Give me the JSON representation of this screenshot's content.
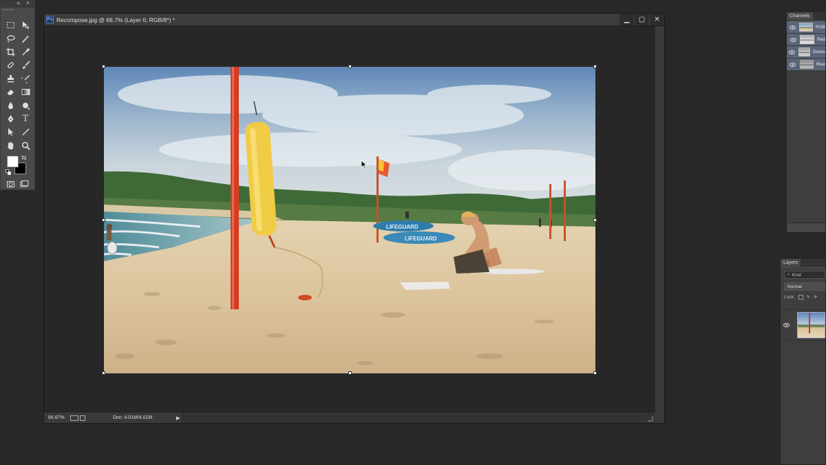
{
  "tools_panel": {
    "collapse_glyph": "«",
    "close_glyph": "×",
    "tools": [
      {
        "name": "rect-marquee-icon"
      },
      {
        "name": "move-icon"
      },
      {
        "name": "lasso-icon"
      },
      {
        "name": "magic-wand-icon"
      },
      {
        "name": "crop-icon"
      },
      {
        "name": "eyedropper-icon"
      },
      {
        "name": "healing-brush-icon"
      },
      {
        "name": "brush-icon"
      },
      {
        "name": "clone-stamp-icon"
      },
      {
        "name": "history-brush-icon"
      },
      {
        "name": "eraser-icon"
      },
      {
        "name": "gradient-icon"
      },
      {
        "name": "blur-icon"
      },
      {
        "name": "dodge-icon"
      },
      {
        "name": "pen-icon"
      },
      {
        "name": "type-icon"
      },
      {
        "name": "path-select-icon"
      },
      {
        "name": "line-icon"
      },
      {
        "name": "hand-icon"
      },
      {
        "name": "zoom-icon"
      }
    ],
    "type_glyph": "T",
    "foreground_color": "#ffffff",
    "background_color": "#000000"
  },
  "document": {
    "title": "Recompose.jpg @ 66.7% (Layer 0, RGB/8*) *",
    "app_icon_text": "Ps",
    "minimize_glyph": "▁",
    "restore_glyph": "▢",
    "close_glyph": "✕",
    "status": {
      "zoom": "66.67%",
      "doc_size": "Doc: 4.01M/4.01M",
      "arrow": "▶"
    }
  },
  "photo": {
    "lifeguard_text_1": "LIFEGUARD",
    "lifeguard_text_2": "LIFEGUARD"
  },
  "channels_panel": {
    "tab": "Channels",
    "channels": [
      {
        "name": "RGB"
      },
      {
        "name": "Red"
      },
      {
        "name": "Green"
      },
      {
        "name": "Blue"
      }
    ]
  },
  "layers_panel": {
    "tab": "Layers",
    "kind_placeholder": "Kind",
    "blend_mode": "Normal",
    "lock_label": "Lock:"
  }
}
